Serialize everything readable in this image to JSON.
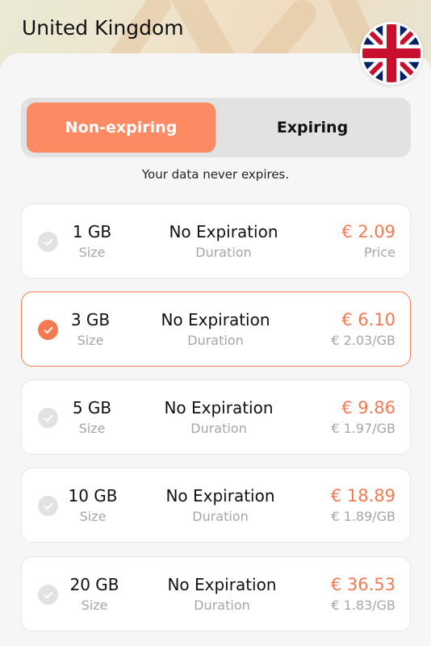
{
  "header": {
    "title": "United Kingdom",
    "flag": "uk-flag"
  },
  "tabs": [
    {
      "label": "Non-expiring",
      "active": true
    },
    {
      "label": "Expiring",
      "active": false
    }
  ],
  "hint": "Your data never expires.",
  "colors": {
    "accent": "#f47a52",
    "tab_active": "#fc8a63",
    "muted": "#a6a6a6"
  },
  "plans": [
    {
      "size": "1 GB",
      "size_label": "Size",
      "duration": "No Expiration",
      "duration_label": "Duration",
      "price": "€ 2.09",
      "price_sub": "Price",
      "selected": false
    },
    {
      "size": "3 GB",
      "size_label": "Size",
      "duration": "No Expiration",
      "duration_label": "Duration",
      "price": "€ 6.10",
      "price_sub": "€ 2.03/GB",
      "selected": true
    },
    {
      "size": "5 GB",
      "size_label": "Size",
      "duration": "No Expiration",
      "duration_label": "Duration",
      "price": "€ 9.86",
      "price_sub": "€ 1.97/GB",
      "selected": false
    },
    {
      "size": "10 GB",
      "size_label": "Size",
      "duration": "No Expiration",
      "duration_label": "Duration",
      "price": "€ 18.89",
      "price_sub": "€ 1.89/GB",
      "selected": false
    },
    {
      "size": "20 GB",
      "size_label": "Size",
      "duration": "No Expiration",
      "duration_label": "Duration",
      "price": "€ 36.53",
      "price_sub": "€ 1.83/GB",
      "selected": false
    }
  ]
}
